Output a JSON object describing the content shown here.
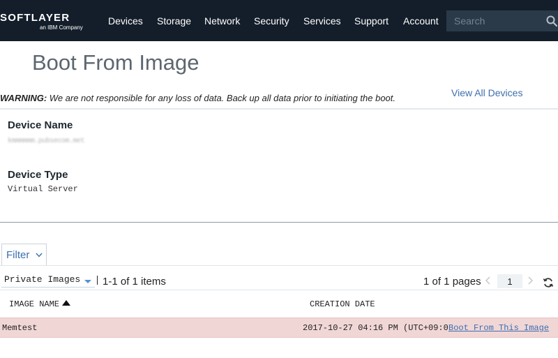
{
  "nav": {
    "logo_text": "SOFTLAYER",
    "logo_sub": "an IBM Company",
    "items": [
      "Devices",
      "Storage",
      "Network",
      "Security",
      "Services",
      "Support",
      "Account"
    ],
    "search_placeholder": "Search"
  },
  "page": {
    "title": "Boot From Image",
    "warning_label": "WARNING:",
    "warning_text": " We are not responsible for any loss of data. Back up all data prior to initiating the boot.",
    "view_all_link": "View All Devices"
  },
  "device": {
    "name_label": "Device Name",
    "name_value": "kmmmmmm.pubsecom.met",
    "type_label": "Device Type",
    "type_value": "Virtual Server"
  },
  "filter": {
    "label": "Filter"
  },
  "toolbar": {
    "image_type_selected": "Private Images",
    "items_count": "1-1 of 1 items",
    "pages": "1 of 1 pages",
    "current_page": "1"
  },
  "table": {
    "columns": [
      "IMAGE NAME",
      "CREATION DATE"
    ],
    "rows": [
      {
        "name": "Memtest",
        "date": "2017-10-27 04:16 PM (UTC+09:0",
        "action": "Boot From This Image"
      }
    ]
  },
  "colors": {
    "nav_bg": "#131e2a",
    "link": "#3c6fb0",
    "row_highlight": "#f1d6d6"
  }
}
